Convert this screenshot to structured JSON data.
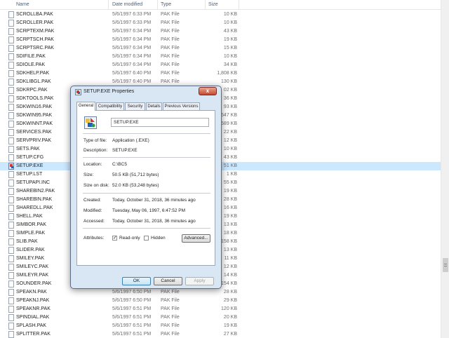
{
  "columns": {
    "name": "Name",
    "date": "Date modified",
    "type": "Type",
    "size": "Size"
  },
  "files": [
    {
      "name": "SCROLLBA.PAK",
      "date": "5/6/1997 6:33 PM",
      "type": "PAK File",
      "size": "10 KB"
    },
    {
      "name": "SCROLLER.PAK",
      "date": "5/6/1997 6:33 PM",
      "type": "PAK File",
      "size": "10 KB"
    },
    {
      "name": "SCRPTEXM.PAK",
      "date": "5/6/1997 6:34 PM",
      "type": "PAK File",
      "size": "43 KB"
    },
    {
      "name": "SCRPTSCH.PAK",
      "date": "5/6/1997 6:34 PM",
      "type": "PAK File",
      "size": "19 KB"
    },
    {
      "name": "SCRPTSRC.PAK",
      "date": "5/6/1997 6:34 PM",
      "type": "PAK File",
      "size": "15 KB"
    },
    {
      "name": "SDIFILE.PAK",
      "date": "5/6/1997 6:34 PM",
      "type": "PAK File",
      "size": "10 KB"
    },
    {
      "name": "SDIOLE.PAK",
      "date": "5/6/1997 6:34 PM",
      "type": "PAK File",
      "size": "34 KB"
    },
    {
      "name": "SDKHELP.PAK",
      "date": "5/6/1997 6:40 PM",
      "type": "PAK File",
      "size": "1,808 KB"
    },
    {
      "name": "SDKLIBGL.PAK",
      "date": "5/6/1997 6:40 PM",
      "type": "PAK File",
      "size": "130 KB"
    },
    {
      "name": "SDKRPC.PAK",
      "date": "",
      "type": "",
      "size": "02 KB"
    },
    {
      "name": "SDKTOOLS.PAK",
      "date": "",
      "type": "",
      "size": "36 KB"
    },
    {
      "name": "SDKWIN16.PAK",
      "date": "",
      "type": "",
      "size": "93 KB"
    },
    {
      "name": "SDKWIN95.PAK",
      "date": "",
      "type": "",
      "size": "547 KB"
    },
    {
      "name": "SDKWINNT.PAK",
      "date": "",
      "type": "",
      "size": "589 KB"
    },
    {
      "name": "SERVICES.PAK",
      "date": "",
      "type": "",
      "size": "22 KB"
    },
    {
      "name": "SERVPRIV.PAK",
      "date": "",
      "type": "",
      "size": "12 KB"
    },
    {
      "name": "SETS.PAK",
      "date": "",
      "type": "",
      "size": "10 KB"
    },
    {
      "name": "SETUP.CFG",
      "date": "",
      "type": "",
      "size": "43 KB"
    },
    {
      "name": "SETUP.EXE",
      "date": "",
      "type": "",
      "size": "51 KB",
      "selected": true,
      "icon": "exe"
    },
    {
      "name": "SETUP.LST",
      "date": "",
      "type": "",
      "size": "1 KB"
    },
    {
      "name": "SETUPAPI.INC",
      "date": "",
      "type": "",
      "size": "55 KB"
    },
    {
      "name": "SHAREBIN2.PAK",
      "date": "",
      "type": "",
      "size": "19 KB"
    },
    {
      "name": "SHAREBIN.PAK",
      "date": "",
      "type": "",
      "size": "28 KB"
    },
    {
      "name": "SHAREDLL.PAK",
      "date": "",
      "type": "",
      "size": "16 KB"
    },
    {
      "name": "SHELL.PAK",
      "date": "",
      "type": "",
      "size": "19 KB"
    },
    {
      "name": "SIMBOR.PAK",
      "date": "",
      "type": "",
      "size": "13 KB"
    },
    {
      "name": "SIMPLE.PAK",
      "date": "",
      "type": "",
      "size": "18 KB"
    },
    {
      "name": "SLIB.PAK",
      "date": "",
      "type": "",
      "size": "158 KB"
    },
    {
      "name": "SLIDER.PAK",
      "date": "",
      "type": "",
      "size": "13 KB"
    },
    {
      "name": "SMILEY.PAK",
      "date": "",
      "type": "",
      "size": "11 KB"
    },
    {
      "name": "SMILEYC.PAK",
      "date": "",
      "type": "",
      "size": "12 KB"
    },
    {
      "name": "SMILEYR.PAK",
      "date": "",
      "type": "",
      "size": "14 KB"
    },
    {
      "name": "SOUNDER.PAK",
      "date": "",
      "type": "",
      "size": "154 KB"
    },
    {
      "name": "SPEAKN.PAK",
      "date": "5/6/1997 6:50 PM",
      "type": "PAK File",
      "size": "28 KB"
    },
    {
      "name": "SPEAKNJ.PAK",
      "date": "5/6/1997 6:50 PM",
      "type": "PAK File",
      "size": "29 KB"
    },
    {
      "name": "SPEAKNR.PAK",
      "date": "5/6/1997 6:51 PM",
      "type": "PAK File",
      "size": "120 KB"
    },
    {
      "name": "SPINDIAL.PAK",
      "date": "5/6/1997 6:51 PM",
      "type": "PAK File",
      "size": "20 KB"
    },
    {
      "name": "SPLASH.PAK",
      "date": "5/6/1997 6:51 PM",
      "type": "PAK File",
      "size": "19 KB"
    },
    {
      "name": "SPLITTER.PAK",
      "date": "5/6/1997 6:51 PM",
      "type": "PAK File",
      "size": "27 KB"
    }
  ],
  "dialog": {
    "title": "SETUP.EXE Properties",
    "close_glyph": "x",
    "tabs": [
      "General",
      "Compatibility",
      "Security",
      "Details",
      "Previous Versions"
    ],
    "active_tab": "General",
    "file_name": "SETUP.EXE",
    "type_label": "Type of file:",
    "type_value": "Application (.EXE)",
    "desc_label": "Description:",
    "desc_value": "SETUP.EXE",
    "location_label": "Location:",
    "location_value": "C:\\BC5",
    "size_label": "Size:",
    "size_value": "50.5 KB (51,712 bytes)",
    "disk_label": "Size on disk:",
    "disk_value": "52.0 KB (53,248 bytes)",
    "created_label": "Created:",
    "created_value": "Today, October 31, 2018, 36 minutes ago",
    "modified_label": "Modified:",
    "modified_value": "Tuesday, May 06, 1997, 6:47:52 PM",
    "accessed_label": "Accessed:",
    "accessed_value": "Today, October 31, 2018, 36 minutes ago",
    "attributes_label": "Attributes:",
    "readonly_label": "Read-only",
    "readonly_checked": true,
    "hidden_label": "Hidden",
    "hidden_checked": false,
    "advanced_label": "Advanced...",
    "ok_label": "OK",
    "cancel_label": "Cancel",
    "apply_label": "Apply"
  },
  "colors": {
    "selection": "#cce8ff",
    "dialog_frame": "#d9e7f4",
    "close_button": "#c44a33"
  }
}
